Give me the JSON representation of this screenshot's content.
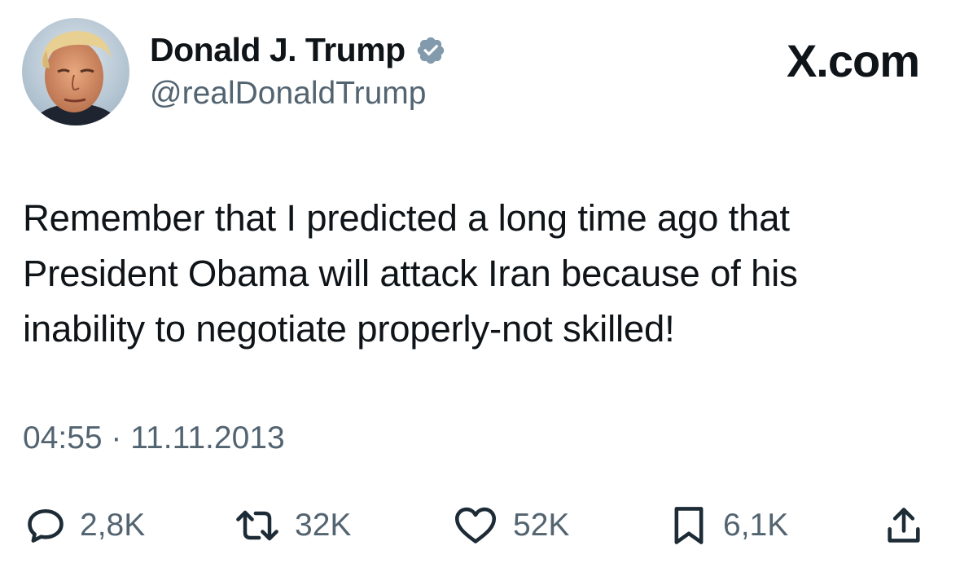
{
  "author": {
    "display_name": "Donald J. Trump",
    "handle": "@realDonaldTrump",
    "verified": true
  },
  "brand": "X.com",
  "tweet": {
    "text": "Remember that I predicted a long time ago that\nPresident Obama will attack Iran because of his\ninability to negotiate properly-not skilled!",
    "timestamp": "04:55 · 11.11.2013"
  },
  "actions": {
    "replies": "2,8K",
    "reposts": "32K",
    "likes": "52K",
    "bookmarks": "6,1K"
  },
  "icons": {
    "avatar": "avatar-photo",
    "verified": "verified-badge-icon",
    "reply": "reply-icon",
    "repost": "repost-icon",
    "like": "heart-icon",
    "bookmark": "bookmark-icon",
    "share": "share-icon"
  },
  "colors": {
    "text": "#0f1419",
    "secondary": "#536471",
    "verified_badge": "#829aab",
    "background": "#ffffff"
  }
}
